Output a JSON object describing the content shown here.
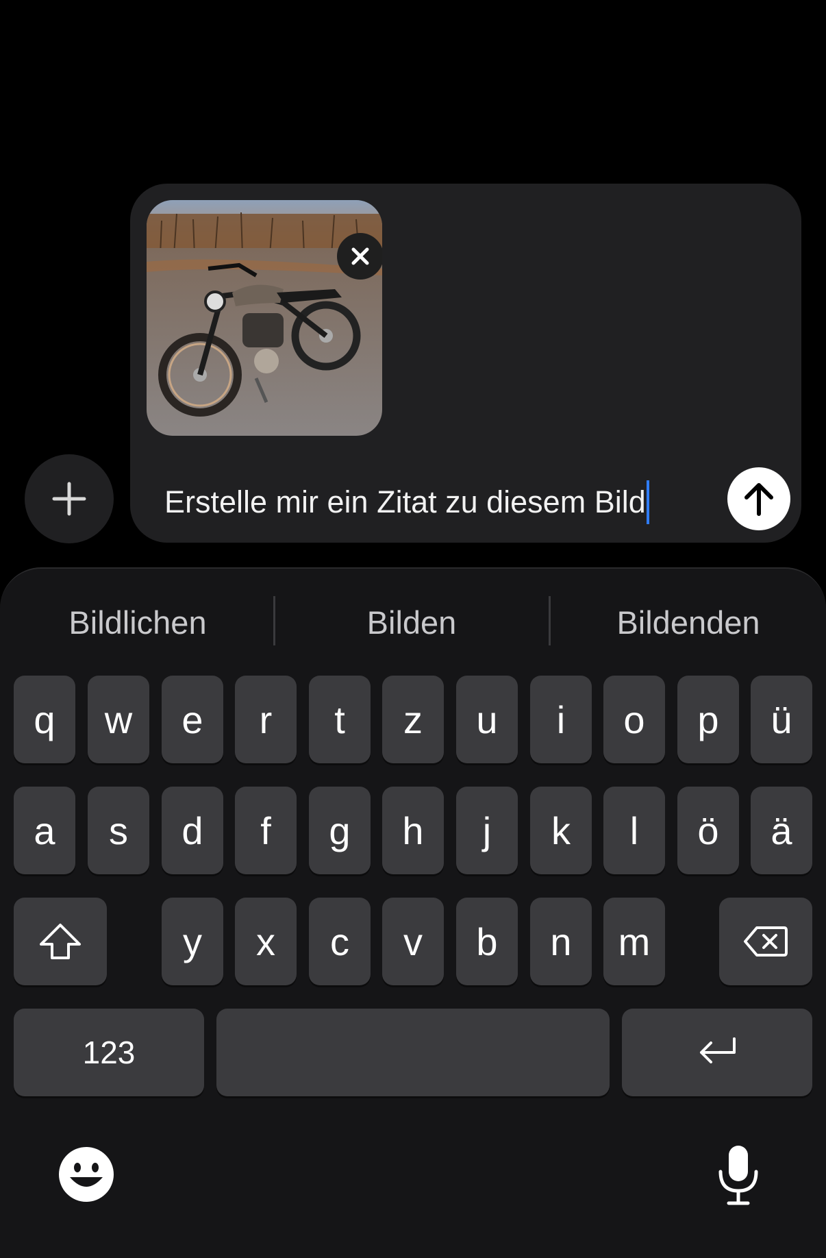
{
  "composer": {
    "message_text": "Erstelle mir ein Zitat zu diesem Bild",
    "attachment_icon": "close-icon",
    "send_icon": "arrow-up-icon",
    "add_icon": "plus-icon"
  },
  "keyboard": {
    "suggestions": [
      "Bildlichen",
      "Bilden",
      "Bildenden"
    ],
    "row1": [
      "q",
      "w",
      "e",
      "r",
      "t",
      "z",
      "u",
      "i",
      "o",
      "p",
      "ü"
    ],
    "row2": [
      "a",
      "s",
      "d",
      "f",
      "g",
      "h",
      "j",
      "k",
      "l",
      "ö",
      "ä"
    ],
    "row3": [
      "y",
      "x",
      "c",
      "v",
      "b",
      "n",
      "m"
    ],
    "numbers_label": "123",
    "icons": {
      "shift": "shift-icon",
      "delete": "backspace-icon",
      "return": "return-icon",
      "emoji": "emoji-icon",
      "dictation": "microphone-icon"
    }
  },
  "colors": {
    "background": "#000000",
    "composer": "#202022",
    "keyboard": "#151517",
    "key": "#3b3b3e",
    "caret": "#2f7cf6"
  }
}
